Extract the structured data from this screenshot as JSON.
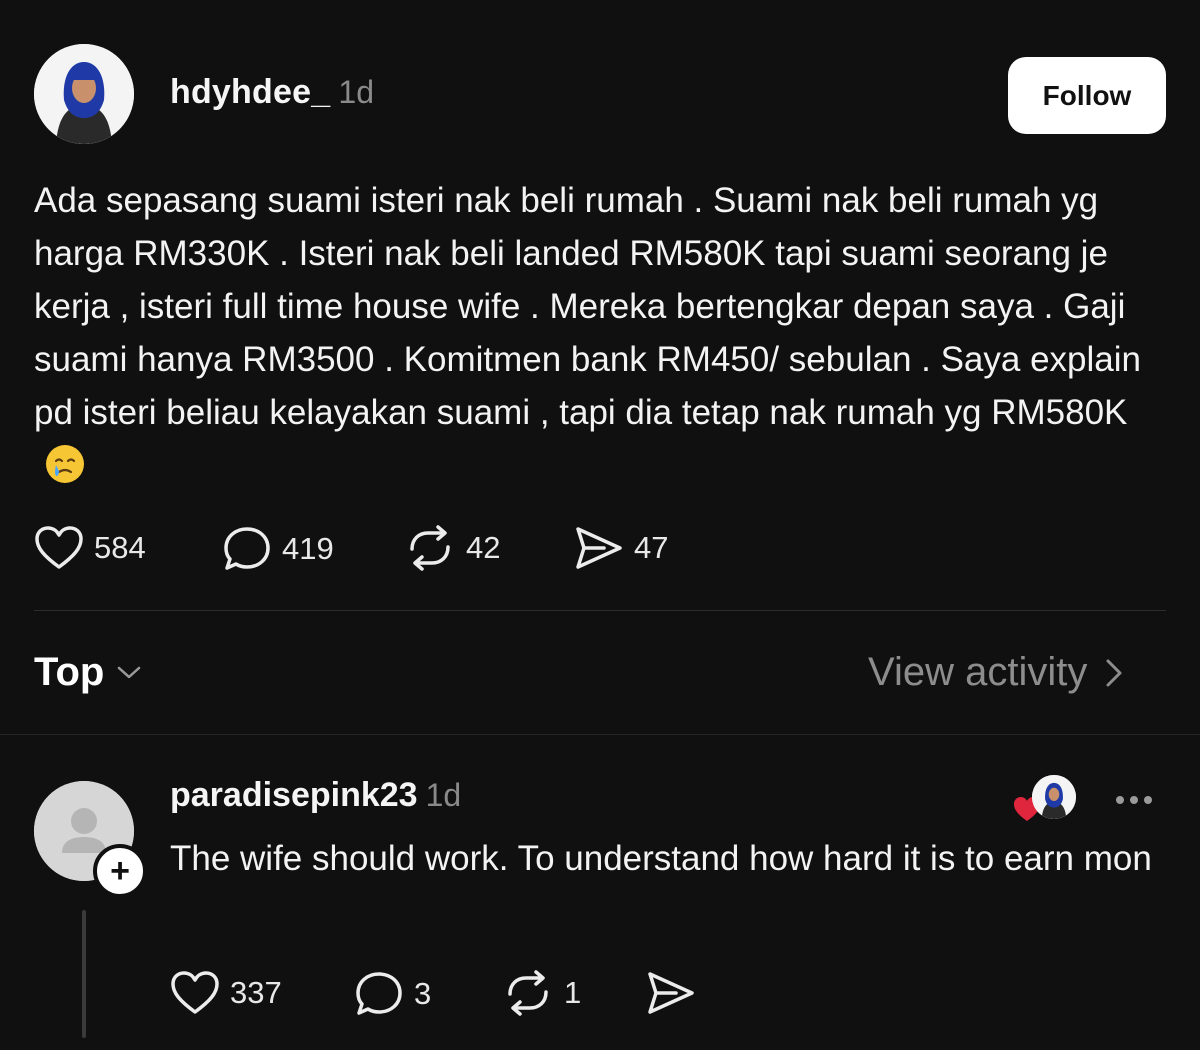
{
  "post": {
    "username": "hdyhdee_",
    "time": "1d",
    "follow_label": "Follow",
    "text": "Ada sepasang suami isteri nak beli rumah . Suami nak beli rumah yg harga RM330K . Isteri nak beli landed RM580K tapi suami seorang je kerja , isteri full time house wife . Mereka bertengkar depan saya . Gaji suami hanya RM3500 . Komitmen bank RM450/ sebulan . Saya explain pd isteri beliau kelayakan suami , tapi dia tetap nak rumah yg RM580K",
    "emoji": "crying-face-emoji",
    "likes": "584",
    "comments": "419",
    "reposts": "42",
    "shares": "47"
  },
  "sort": {
    "label": "Top",
    "view_activity": "View activity"
  },
  "reply": {
    "username": "paradisepink23",
    "time": "1d",
    "text": "The wife should work. To understand how hard it is to earn mon",
    "likes": "337",
    "comments": "3",
    "reposts": "1"
  },
  "colors": {
    "background": "#101010",
    "accent_heart": "#e0263c",
    "muted_text": "#8a8a8a"
  }
}
